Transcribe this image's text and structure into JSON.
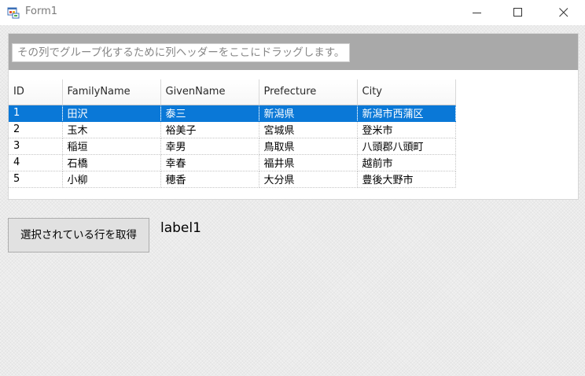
{
  "window": {
    "title": "Form1"
  },
  "grid": {
    "group_panel_hint": "その列でグループ化するために列ヘッダーをここにドラッグします。",
    "columns": [
      "ID",
      "FamilyName",
      "GivenName",
      "Prefecture",
      "City"
    ],
    "rows": [
      {
        "id": "1",
        "family_name": "田沢",
        "given_name": "泰三",
        "prefecture": "新潟県",
        "city": "新潟市西蒲区",
        "selected": true
      },
      {
        "id": "2",
        "family_name": "玉木",
        "given_name": "裕美子",
        "prefecture": "宮城県",
        "city": "登米市",
        "selected": false
      },
      {
        "id": "3",
        "family_name": "稲垣",
        "given_name": "幸男",
        "prefecture": "鳥取県",
        "city": "八頭郡八頭町",
        "selected": false
      },
      {
        "id": "4",
        "family_name": "石橋",
        "given_name": "幸春",
        "prefecture": "福井県",
        "city": "越前市",
        "selected": false
      },
      {
        "id": "5",
        "family_name": "小柳",
        "given_name": "穂香",
        "prefecture": "大分県",
        "city": "豊後大野市",
        "selected": false
      }
    ],
    "selection_color": "#0a78d7"
  },
  "actions": {
    "get_selected_row_label": "選択されている行を取得"
  },
  "output": {
    "label1": "label1"
  },
  "icons": {
    "app": "form-app-icon",
    "minimize": "minimize-icon",
    "maximize": "maximize-icon",
    "close": "close-icon"
  }
}
